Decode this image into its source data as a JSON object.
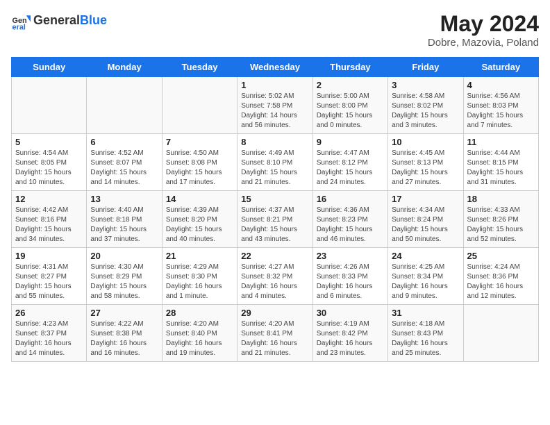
{
  "header": {
    "logo_text_general": "General",
    "logo_text_blue": "Blue",
    "month_title": "May 2024",
    "location": "Dobre, Mazovia, Poland"
  },
  "days_of_week": [
    "Sunday",
    "Monday",
    "Tuesday",
    "Wednesday",
    "Thursday",
    "Friday",
    "Saturday"
  ],
  "weeks": [
    [
      {
        "day": "",
        "info": ""
      },
      {
        "day": "",
        "info": ""
      },
      {
        "day": "",
        "info": ""
      },
      {
        "day": "1",
        "info": "Sunrise: 5:02 AM\nSunset: 7:58 PM\nDaylight: 14 hours\nand 56 minutes."
      },
      {
        "day": "2",
        "info": "Sunrise: 5:00 AM\nSunset: 8:00 PM\nDaylight: 15 hours\nand 0 minutes."
      },
      {
        "day": "3",
        "info": "Sunrise: 4:58 AM\nSunset: 8:02 PM\nDaylight: 15 hours\nand 3 minutes."
      },
      {
        "day": "4",
        "info": "Sunrise: 4:56 AM\nSunset: 8:03 PM\nDaylight: 15 hours\nand 7 minutes."
      }
    ],
    [
      {
        "day": "5",
        "info": "Sunrise: 4:54 AM\nSunset: 8:05 PM\nDaylight: 15 hours\nand 10 minutes."
      },
      {
        "day": "6",
        "info": "Sunrise: 4:52 AM\nSunset: 8:07 PM\nDaylight: 15 hours\nand 14 minutes."
      },
      {
        "day": "7",
        "info": "Sunrise: 4:50 AM\nSunset: 8:08 PM\nDaylight: 15 hours\nand 17 minutes."
      },
      {
        "day": "8",
        "info": "Sunrise: 4:49 AM\nSunset: 8:10 PM\nDaylight: 15 hours\nand 21 minutes."
      },
      {
        "day": "9",
        "info": "Sunrise: 4:47 AM\nSunset: 8:12 PM\nDaylight: 15 hours\nand 24 minutes."
      },
      {
        "day": "10",
        "info": "Sunrise: 4:45 AM\nSunset: 8:13 PM\nDaylight: 15 hours\nand 27 minutes."
      },
      {
        "day": "11",
        "info": "Sunrise: 4:44 AM\nSunset: 8:15 PM\nDaylight: 15 hours\nand 31 minutes."
      }
    ],
    [
      {
        "day": "12",
        "info": "Sunrise: 4:42 AM\nSunset: 8:16 PM\nDaylight: 15 hours\nand 34 minutes."
      },
      {
        "day": "13",
        "info": "Sunrise: 4:40 AM\nSunset: 8:18 PM\nDaylight: 15 hours\nand 37 minutes."
      },
      {
        "day": "14",
        "info": "Sunrise: 4:39 AM\nSunset: 8:20 PM\nDaylight: 15 hours\nand 40 minutes."
      },
      {
        "day": "15",
        "info": "Sunrise: 4:37 AM\nSunset: 8:21 PM\nDaylight: 15 hours\nand 43 minutes."
      },
      {
        "day": "16",
        "info": "Sunrise: 4:36 AM\nSunset: 8:23 PM\nDaylight: 15 hours\nand 46 minutes."
      },
      {
        "day": "17",
        "info": "Sunrise: 4:34 AM\nSunset: 8:24 PM\nDaylight: 15 hours\nand 50 minutes."
      },
      {
        "day": "18",
        "info": "Sunrise: 4:33 AM\nSunset: 8:26 PM\nDaylight: 15 hours\nand 52 minutes."
      }
    ],
    [
      {
        "day": "19",
        "info": "Sunrise: 4:31 AM\nSunset: 8:27 PM\nDaylight: 15 hours\nand 55 minutes."
      },
      {
        "day": "20",
        "info": "Sunrise: 4:30 AM\nSunset: 8:29 PM\nDaylight: 15 hours\nand 58 minutes."
      },
      {
        "day": "21",
        "info": "Sunrise: 4:29 AM\nSunset: 8:30 PM\nDaylight: 16 hours\nand 1 minute."
      },
      {
        "day": "22",
        "info": "Sunrise: 4:27 AM\nSunset: 8:32 PM\nDaylight: 16 hours\nand 4 minutes."
      },
      {
        "day": "23",
        "info": "Sunrise: 4:26 AM\nSunset: 8:33 PM\nDaylight: 16 hours\nand 6 minutes."
      },
      {
        "day": "24",
        "info": "Sunrise: 4:25 AM\nSunset: 8:34 PM\nDaylight: 16 hours\nand 9 minutes."
      },
      {
        "day": "25",
        "info": "Sunrise: 4:24 AM\nSunset: 8:36 PM\nDaylight: 16 hours\nand 12 minutes."
      }
    ],
    [
      {
        "day": "26",
        "info": "Sunrise: 4:23 AM\nSunset: 8:37 PM\nDaylight: 16 hours\nand 14 minutes."
      },
      {
        "day": "27",
        "info": "Sunrise: 4:22 AM\nSunset: 8:38 PM\nDaylight: 16 hours\nand 16 minutes."
      },
      {
        "day": "28",
        "info": "Sunrise: 4:20 AM\nSunset: 8:40 PM\nDaylight: 16 hours\nand 19 minutes."
      },
      {
        "day": "29",
        "info": "Sunrise: 4:20 AM\nSunset: 8:41 PM\nDaylight: 16 hours\nand 21 minutes."
      },
      {
        "day": "30",
        "info": "Sunrise: 4:19 AM\nSunset: 8:42 PM\nDaylight: 16 hours\nand 23 minutes."
      },
      {
        "day": "31",
        "info": "Sunrise: 4:18 AM\nSunset: 8:43 PM\nDaylight: 16 hours\nand 25 minutes."
      },
      {
        "day": "",
        "info": ""
      }
    ]
  ]
}
